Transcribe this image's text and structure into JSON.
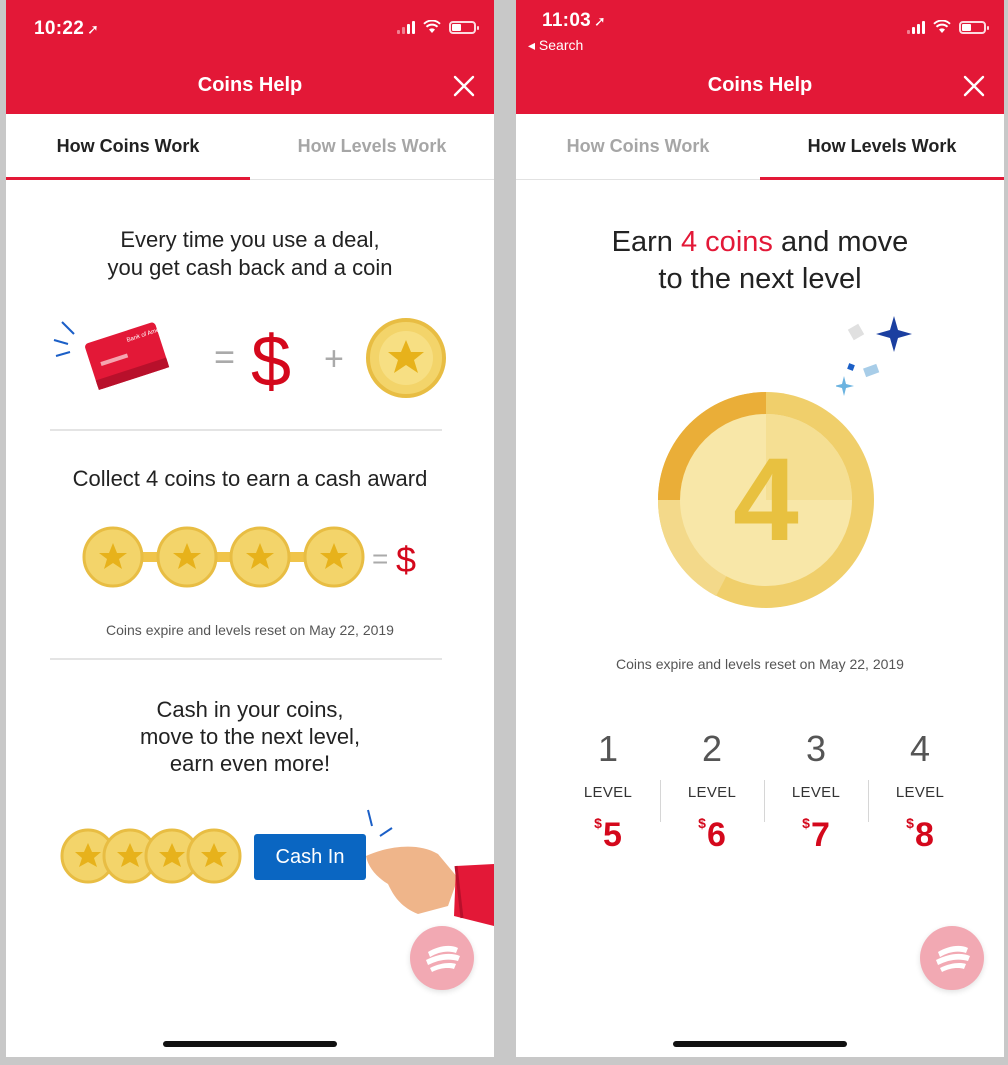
{
  "colors": {
    "brand_red": "#e31837",
    "button_blue": "#0a66c2",
    "coin_gold": "#f3d46a",
    "amount_red": "#d4081c"
  },
  "left_screen": {
    "status_time": "10:22",
    "nav_title": "Coins Help",
    "close_icon": "close-icon",
    "tabs": [
      {
        "label": "How Coins Work",
        "active": true
      },
      {
        "label": "How Levels Work",
        "active": false
      }
    ],
    "section1": {
      "line1": "Every time you use a deal,",
      "line2": "you get cash back and a coin",
      "card_brand": "Bank of America"
    },
    "equation": {
      "equals": "=",
      "dollar": "$",
      "plus": "+"
    },
    "section2": {
      "heading": "Collect 4 coins to earn a cash award",
      "equals": "=",
      "dollar": "$",
      "note": "Coins expire and levels reset on May 22, 2019"
    },
    "section3": {
      "line1": "Cash in your coins,",
      "line2": "move to the next level,",
      "line3": "earn even more!",
      "button_label": "Cash In"
    }
  },
  "right_screen": {
    "status_time": "11:03",
    "back_label": "◂ Search",
    "nav_title": "Coins Help",
    "tabs": [
      {
        "label": "How Coins Work",
        "active": false
      },
      {
        "label": "How Levels Work",
        "active": true
      }
    ],
    "heading": {
      "prefix": "Earn ",
      "highlight": "4 coins",
      "suffix": " and move",
      "line2": "to the next level"
    },
    "coin_number": "4",
    "note": "Coins expire and levels reset on May 22, 2019",
    "levels": [
      {
        "num": "1",
        "label": "LEVEL",
        "currency": "$",
        "amount": "5"
      },
      {
        "num": "2",
        "label": "LEVEL",
        "currency": "$",
        "amount": "6"
      },
      {
        "num": "3",
        "label": "LEVEL",
        "currency": "$",
        "amount": "7"
      },
      {
        "num": "4",
        "label": "LEVEL",
        "currency": "$",
        "amount": "8"
      }
    ]
  }
}
